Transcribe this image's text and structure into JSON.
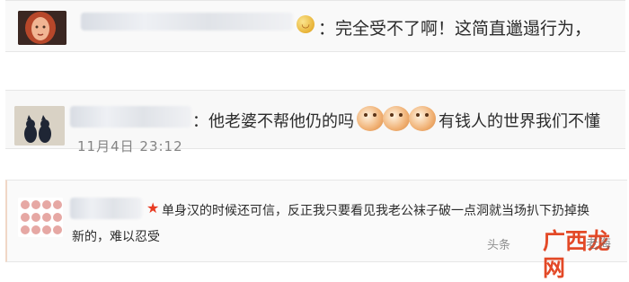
{
  "comments": [
    {
      "text": "：完全受不了啊！这简直邋遢行为，"
    },
    {
      "text": "：他老婆不帮他仍的吗",
      "after_emoji_text": "有钱人的世界我们不懂",
      "timestamp": "11月4日 23:12"
    },
    {
      "text_line1": "单身汉的时候还可信，反正我只要看见我老公袜子破一点洞就当场扒下扔掉换",
      "text_line2": "新的，难以忍受"
    }
  ],
  "watermark": {
    "left": "头条",
    "logo": "广西龙网",
    "right": "老海"
  },
  "colors": {
    "accent_red": "#e34927",
    "star_red": "#e83b22"
  }
}
